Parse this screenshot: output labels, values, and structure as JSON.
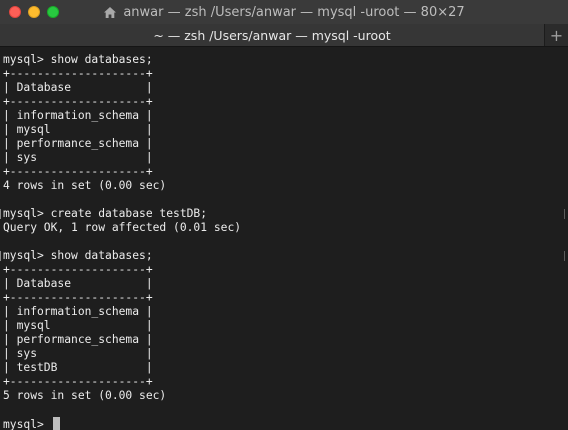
{
  "window": {
    "title": "anwar — zsh /Users/anwar — mysql -uroot — 80×27",
    "tab_title": "~ — zsh /Users/anwar — mysql -uroot",
    "new_tab_label": "+"
  },
  "terminal": {
    "lines": [
      "mysql> show databases;",
      "+--------------------+",
      "| Database           |",
      "+--------------------+",
      "| information_schema |",
      "| mysql              |",
      "| performance_schema |",
      "| sys                |",
      "+--------------------+",
      "4 rows in set (0.00 sec)",
      "",
      "mysql> create database testDB;",
      "Query OK, 1 row affected (0.01 sec)",
      "",
      "mysql> show databases;",
      "+--------------------+",
      "| Database           |",
      "+--------------------+",
      "| information_schema |",
      "| mysql              |",
      "| performance_schema |",
      "| sys                |",
      "| testDB             |",
      "+--------------------+",
      "5 rows in set (0.00 sec)",
      "",
      "mysql> "
    ]
  },
  "colors": {
    "background": "#1e1e1e",
    "text": "#ececec",
    "titlebar": "#3a3a3a"
  }
}
